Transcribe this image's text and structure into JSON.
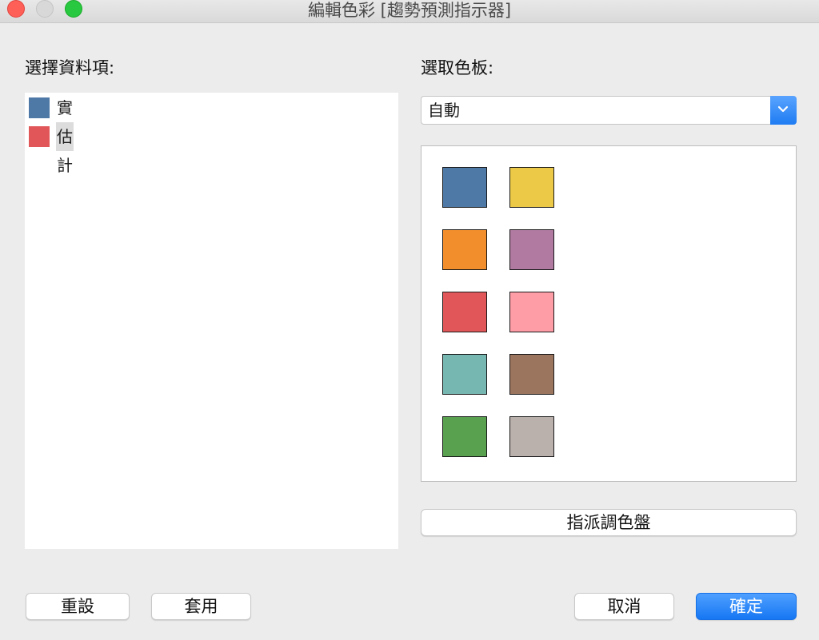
{
  "window": {
    "title": "編輯色彩 [趨勢預測指示器]"
  },
  "left": {
    "label": "選擇資料項:",
    "items": [
      {
        "label": "實際",
        "color": "#4e79a7",
        "selected": false
      },
      {
        "label": "估計",
        "color": "#e15759",
        "selected": true
      }
    ]
  },
  "right": {
    "label": "選取色板:",
    "palette_select": {
      "value": "自動"
    },
    "swatches": [
      {
        "name": "blue",
        "color": "#4e79a7"
      },
      {
        "name": "yellow",
        "color": "#edc948"
      },
      {
        "name": "orange",
        "color": "#f28e2b"
      },
      {
        "name": "purple",
        "color": "#b07aa1"
      },
      {
        "name": "red",
        "color": "#e15759"
      },
      {
        "name": "pink",
        "color": "#ff9da7"
      },
      {
        "name": "teal",
        "color": "#76b7b2"
      },
      {
        "name": "brown",
        "color": "#9c755f"
      },
      {
        "name": "green",
        "color": "#59a14f"
      },
      {
        "name": "gray",
        "color": "#bab0ac"
      }
    ],
    "assign_button": "指派調色盤"
  },
  "buttons": {
    "reset": "重設",
    "apply": "套用",
    "cancel": "取消",
    "ok": "確定"
  }
}
